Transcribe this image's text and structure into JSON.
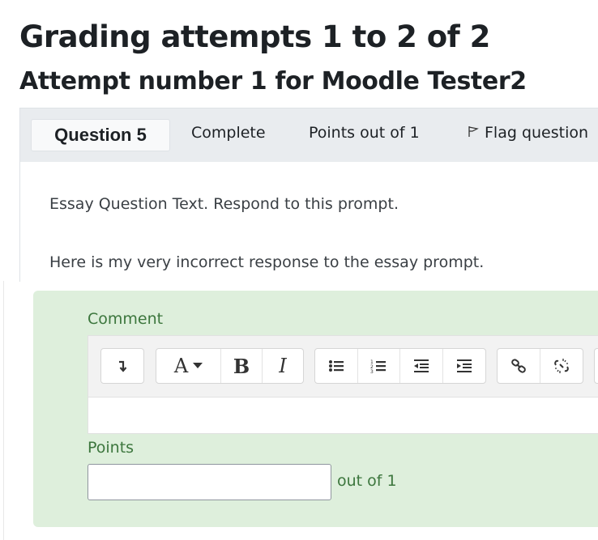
{
  "page": {
    "title": "Grading attempts 1 to 2 of 2",
    "subtitle": "Attempt number 1 for Moodle Tester2"
  },
  "question": {
    "number_label": "Question 5",
    "state": "Complete",
    "points": "Points out of 1",
    "flag_label": "Flag question",
    "text": "Essay Question Text. Respond to this prompt.",
    "response": "Here is my very incorrect response to the essay prompt."
  },
  "grading": {
    "comment_label": "Comment",
    "comment_value": "",
    "points_label": "Points",
    "points_value": "",
    "out_of": "out of 1"
  },
  "toolbar": {
    "font_button": "A",
    "bold_button": "B",
    "italic_button": "I",
    "icons": [
      "collapse-toggle-icon",
      "font-style-icon",
      "bold-icon",
      "italic-icon",
      "unordered-list-icon",
      "ordered-list-icon",
      "outdent-icon",
      "indent-icon",
      "link-icon",
      "unlink-icon"
    ]
  },
  "colors": {
    "header_bg": "#e9ecef",
    "grading_bg": "#deefdc",
    "grading_text": "#3c763d"
  }
}
